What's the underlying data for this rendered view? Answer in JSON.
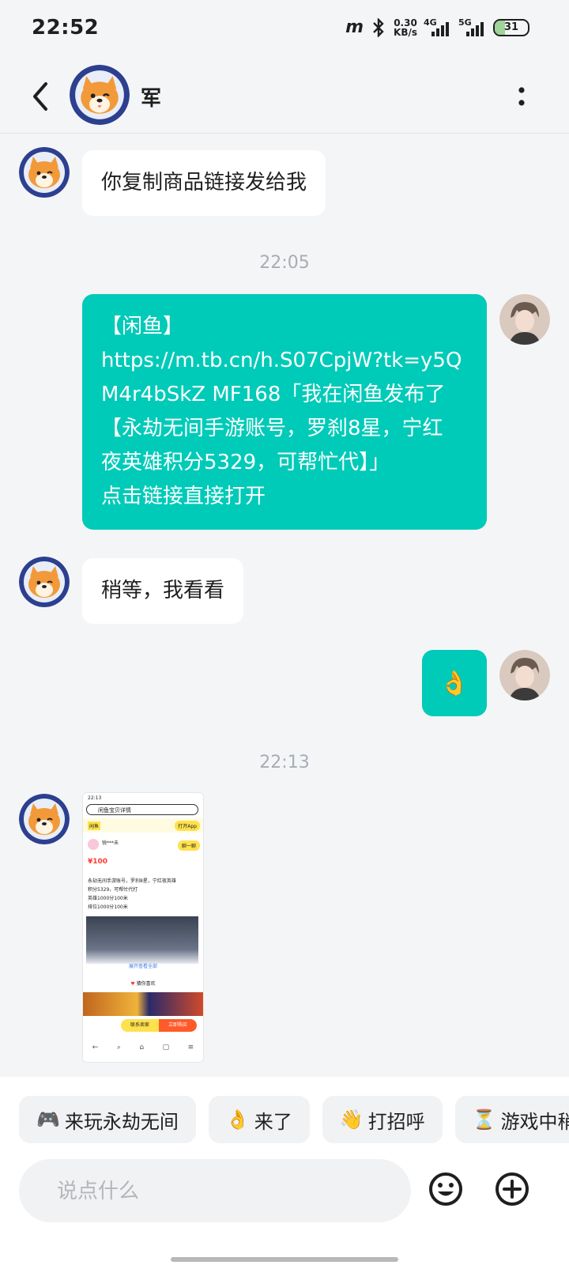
{
  "status": {
    "time": "22:52",
    "speed_value": "0.30",
    "speed_unit": "KB/s",
    "net1": "4G",
    "net2": "5G",
    "battery": "31"
  },
  "header": {
    "name": "军"
  },
  "messages": [
    {
      "type": "in",
      "lines": [
        "你复制商品链接发给我"
      ]
    },
    {
      "type": "time",
      "text": "22:05"
    },
    {
      "type": "out",
      "lines": [
        "【闲鱼】",
        "https://m.tb.cn/h.S07CpjW?tk=y5Q",
        "M4r4bSkZ MF168「我在闲鱼发布了",
        "【永劫无间手游账号，罗刹8星，宁红",
        "夜英雄积分5329，可帮忙代】」",
        "点击链接直接打开"
      ]
    },
    {
      "type": "in",
      "lines": [
        "稍等，我看看"
      ]
    },
    {
      "type": "out",
      "emoji": "👌"
    },
    {
      "type": "time",
      "text": "22:13"
    }
  ],
  "thumbnail": {
    "time": "22:13",
    "search": "闲鱼宝贝详情",
    "brand": "闲鱼",
    "open_app": "打开App",
    "seller": "锐***未",
    "seller_btn": "聊一聊",
    "price": "¥100",
    "desc": [
      "永劫无间手游账号，罗刹8星，宁红夜英雄",
      "积分5329，可帮忙代打",
      "英雄1000分100米",
      "排位1000分100米"
    ],
    "expand": "展开查看全部",
    "guess": "猜你喜欢",
    "contact": "联系卖家",
    "buy": "立即购买"
  },
  "quick_replies": [
    {
      "emoji": "🎮",
      "label": "来玩永劫无间"
    },
    {
      "emoji": "👌",
      "label": "来了"
    },
    {
      "emoji": "👋",
      "label": "打招呼"
    },
    {
      "emoji": "⏳",
      "label": "游戏中稍"
    }
  ],
  "input": {
    "placeholder": "说点什么"
  },
  "colors": {
    "accent": "#00cbb8",
    "background": "#f4f5f7"
  }
}
